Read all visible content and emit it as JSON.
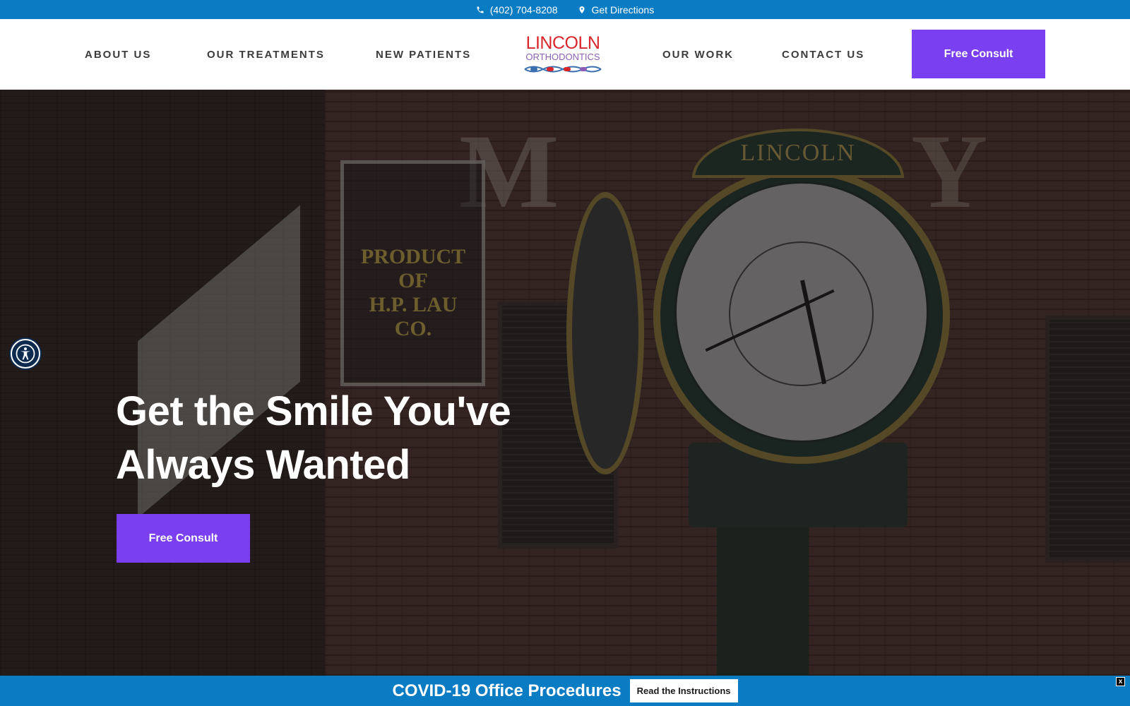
{
  "topbar": {
    "phone": "(402) 704-8208",
    "directions": "Get Directions",
    "phone_icon": "phone-icon",
    "directions_icon": "map-pin-icon"
  },
  "nav": {
    "about": "ABOUT US",
    "treatments": "OUR TREATMENTS",
    "new_patients": "NEW PATIENTS",
    "work": "OUR WORK",
    "contact": "CONTACT US",
    "cta": "Free Consult"
  },
  "logo": {
    "line1": "LINCOLN",
    "line2": "ORTHODONTICS"
  },
  "hero": {
    "title_line1": "Get the Smile You've",
    "title_line2": "Always Wanted",
    "cta": "Free Consult",
    "clock_banner": "LINCOLN",
    "sign_text_1": "PRODUCT",
    "sign_text_2": "OF",
    "sign_text_3": "H.P. LAU",
    "sign_text_4": "CO."
  },
  "covid": {
    "title": "COVID-19 Office Procedures",
    "button": "Read the Instructions",
    "close": "x"
  },
  "colors": {
    "brand_blue": "#0a7cc4",
    "cta_purple": "#7a3ff0",
    "logo_red": "#d9262b",
    "logo_purple": "#8b5fb8"
  },
  "accessibility": {
    "icon": "accessibility-icon"
  }
}
